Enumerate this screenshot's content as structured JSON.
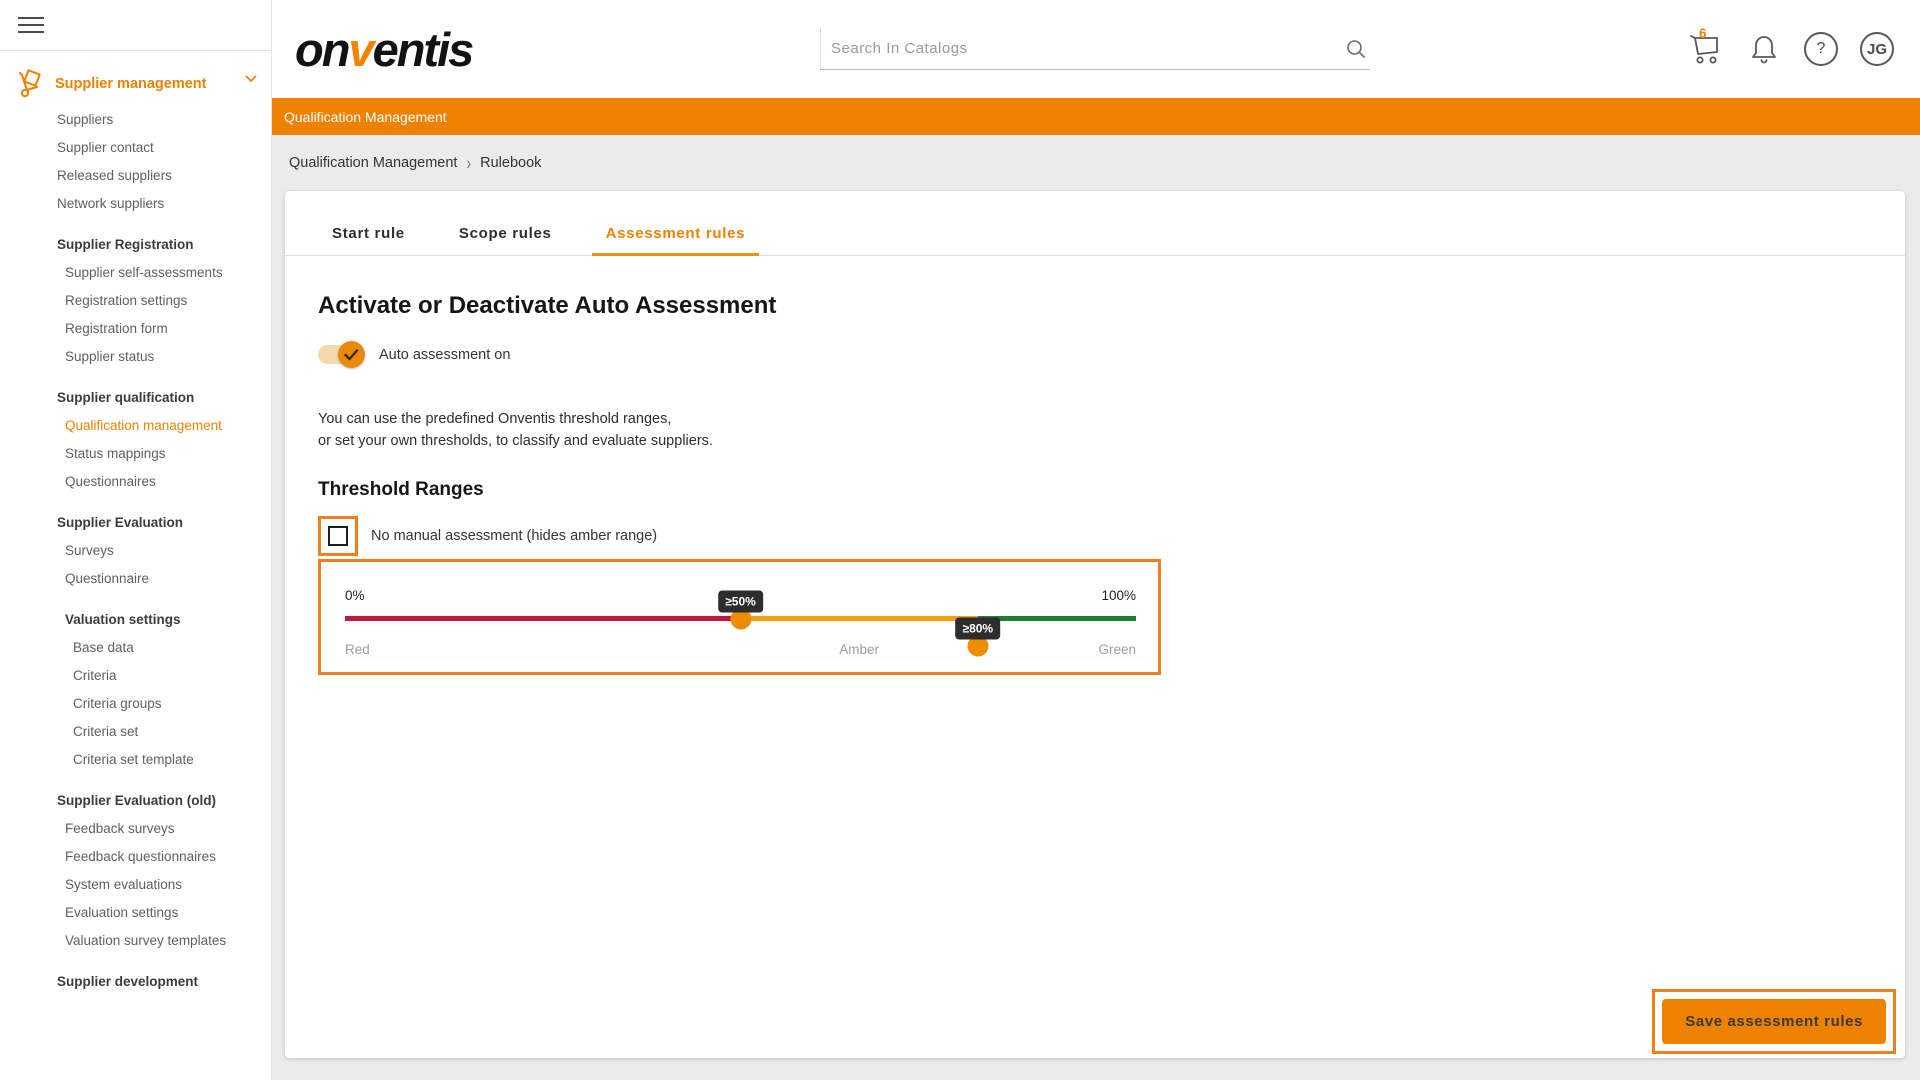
{
  "colors": {
    "accent": "#ee8200",
    "annotation_box": "#ee7f1c",
    "slider_red": "#c2173b",
    "slider_amber": "#f0a112",
    "slider_green": "#1e7d33",
    "toggle_track": "#f6d8ae"
  },
  "icons": [
    "hamburger-icon",
    "handtruck-icon",
    "chevron-down-icon",
    "search-icon",
    "cart-icon",
    "bell-icon",
    "help-icon",
    "avatar-badge"
  ],
  "header": {
    "logo_part1": "on",
    "logo_v": "v",
    "logo_part2": "entis",
    "search_placeholder": "Search In Catalogs",
    "cart_badge": "6",
    "help_glyph": "?",
    "avatar_initials": "JG"
  },
  "sidebar": {
    "root": {
      "label": "Supplier management"
    },
    "items_top": [
      "Suppliers",
      "Supplier contact",
      "Released suppliers",
      "Network suppliers"
    ],
    "sections": [
      {
        "heading": "Supplier Registration",
        "items": [
          "Supplier self-assessments",
          "Registration settings",
          "Registration form",
          "Supplier status"
        ]
      },
      {
        "heading": "Supplier qualification",
        "items": [
          "Qualification management",
          "Status mappings",
          "Questionnaires"
        ],
        "active_item": "Qualification management"
      },
      {
        "heading": "Supplier Evaluation",
        "items": [
          "Surveys",
          "Questionnaire"
        ]
      },
      {
        "heading": "Valuation settings",
        "items": [
          "Base data",
          "Criteria",
          "Criteria groups",
          "Criteria set",
          "Criteria set template"
        ]
      },
      {
        "heading": "Supplier Evaluation (old)",
        "items": [
          "Feedback surveys",
          "Feedback questionnaires",
          "System evaluations",
          "Evaluation settings",
          "Valuation survey templates"
        ]
      },
      {
        "heading": "Supplier development",
        "items": []
      }
    ]
  },
  "banner": {
    "title": "Qualification Management"
  },
  "breadcrumb": {
    "items": [
      "Qualification Management",
      "Rulebook"
    ],
    "separator": "›"
  },
  "tabs": [
    {
      "label": "Start rule",
      "active": false
    },
    {
      "label": "Scope rules",
      "active": false
    },
    {
      "label": "Assessment rules",
      "active": true
    }
  ],
  "main": {
    "section1_title": "Activate or Deactivate Auto Assessment",
    "toggle_label": "Auto assessment on",
    "toggle_state": "on",
    "description_line1": "You can use the predefined Onventis threshold ranges,",
    "description_line2": "or set your own thresholds, to classify and evaluate suppliers.",
    "section2_title": "Threshold Ranges",
    "checkbox_label": "No manual assessment (hides amber range)",
    "checkbox_checked": false,
    "slider": {
      "min_label": "0%",
      "max_label": "100%",
      "handle1_value": 50,
      "handle2_value": 80,
      "handle1_tooltip": "≥50%",
      "handle2_tooltip": "≥80%",
      "zone_labels": [
        "Red",
        "Amber",
        "Green"
      ]
    },
    "save_button_label": "Save assessment rules"
  }
}
